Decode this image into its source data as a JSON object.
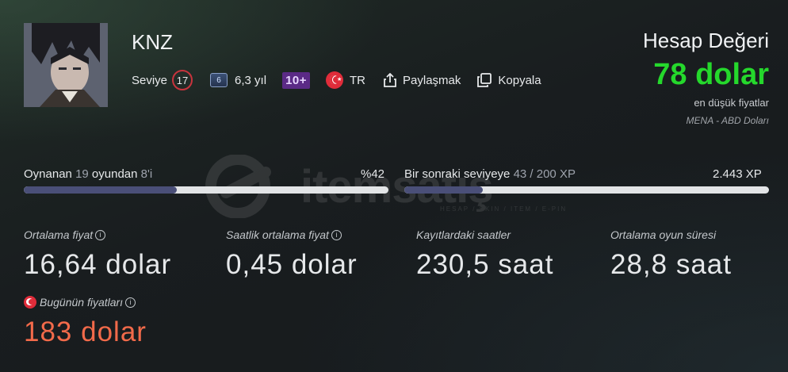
{
  "profile": {
    "username": "KNZ",
    "level_label": "Seviye",
    "level": "17",
    "years_icon_text": "6",
    "years_text": "6,3 yıl",
    "games_badge": "10+",
    "country": "TR",
    "share_label": "Paylaşmak",
    "copy_label": "Kopyala"
  },
  "account_value": {
    "title": "Hesap Değeri",
    "amount": "78 dolar",
    "note": "en düşük fiyatlar",
    "region": "MENA - ABD Doları"
  },
  "progress": {
    "games_played_prefix": "Oynanan",
    "games_played_count": "19",
    "games_played_mid": "oyundan",
    "games_total": "8'i",
    "games_percent": "%42",
    "games_fraction": 0.42,
    "next_level_prefix": "Bir sonraki seviyeye",
    "xp_progress": "43 / 200 XP",
    "xp_total": "2.443 XP",
    "xp_fraction": 0.215
  },
  "stats": [
    {
      "label": "Ortalama fiyat",
      "value": "16,64 dolar"
    },
    {
      "label": "Saatlik ortalama fiyat",
      "value": "0,45 dolar"
    },
    {
      "label": "Kayıtlardaki saatler",
      "value": "230,5 saat"
    },
    {
      "label": "Ortalama oyun süresi",
      "value": "28,8 saat"
    }
  ],
  "today": {
    "label": "Bugünün fiyatları",
    "value": "183 dolar"
  },
  "icons": {
    "share": "share-icon",
    "copy": "copy-icon",
    "info": "info-icon",
    "flag": "turkey-flag-icon"
  },
  "colors": {
    "accent_green": "#25d82c",
    "today_orange": "#f26a4a",
    "progress_fill": "#4a4f78",
    "level_ring": "#c8343d",
    "games_badge_bg": "#5b2a86"
  }
}
